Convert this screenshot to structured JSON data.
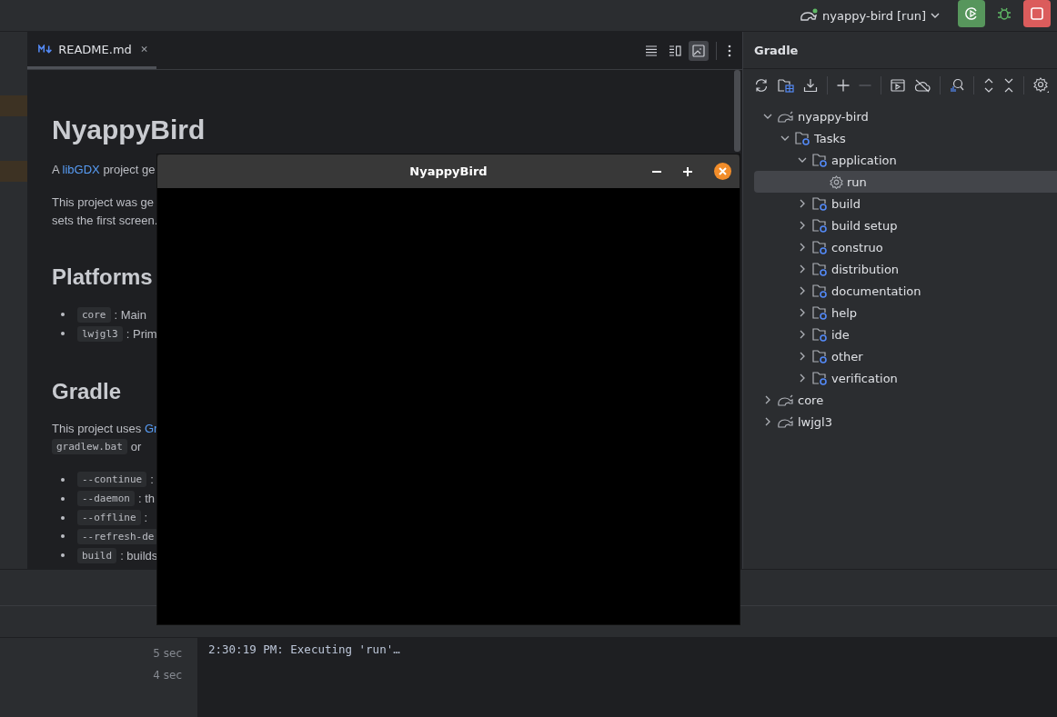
{
  "top_bar": {
    "run_config": "nyappy-bird [run]"
  },
  "editor": {
    "tabs": [
      {
        "label": "README.md",
        "selected": true
      }
    ],
    "view_modes": [
      {
        "kind": "editor",
        "selected": false
      },
      {
        "kind": "split",
        "selected": false
      },
      {
        "kind": "preview",
        "selected": true
      }
    ],
    "readme": [
      {
        "kind": "h1",
        "text": "NyappyBird"
      },
      {
        "kind": "p",
        "lines": [
          [
            {
              "kind": "text",
              "text": "A "
            },
            {
              "kind": "link",
              "text": "libGDX"
            },
            {
              "kind": "text",
              "text": " project ge"
            }
          ]
        ]
      },
      {
        "kind": "p",
        "lines": [
          [
            {
              "kind": "text",
              "text": "This project was ge"
            }
          ],
          [
            {
              "kind": "text",
              "text": "sets the first screen."
            }
          ]
        ]
      },
      {
        "kind": "h2",
        "text": "Platforms"
      },
      {
        "kind": "list",
        "items": [
          [
            {
              "kind": "code",
              "text": "core"
            },
            {
              "kind": "text",
              "text": ": Main"
            }
          ],
          [
            {
              "kind": "code",
              "text": "lwjgl3"
            },
            {
              "kind": "text",
              "text": ": Prim"
            }
          ]
        ]
      },
      {
        "kind": "h2",
        "text": "Gradle"
      },
      {
        "kind": "p",
        "lines": [
          [
            {
              "kind": "text",
              "text": "This project uses "
            },
            {
              "kind": "link",
              "text": "Gr"
            }
          ],
          [
            {
              "kind": "code",
              "text": "gradlew.bat"
            },
            {
              "kind": "text",
              "text": "or"
            }
          ]
        ]
      },
      {
        "kind": "list",
        "items": [
          [
            {
              "kind": "code",
              "text": "--continue"
            },
            {
              "kind": "text",
              "text": ":"
            }
          ],
          [
            {
              "kind": "code",
              "text": "--daemon"
            },
            {
              "kind": "text",
              "text": ": th"
            }
          ],
          [
            {
              "kind": "code",
              "text": "--offline"
            },
            {
              "kind": "text",
              "text": ":"
            }
          ],
          [
            {
              "kind": "code",
              "text": "--refresh-de"
            }
          ],
          [
            {
              "kind": "code",
              "text": "build"
            },
            {
              "kind": "text",
              "text": ": builds"
            }
          ]
        ]
      }
    ]
  },
  "game_window": {
    "title": "NyappyBird"
  },
  "gradle": {
    "title": "Gradle",
    "tree": [
      {
        "label": "nyappy-bird",
        "kind": "project",
        "expanded": true,
        "selected": false,
        "children": [
          {
            "label": "Tasks",
            "kind": "folder",
            "expanded": true,
            "selected": false,
            "children": [
              {
                "label": "application",
                "kind": "folder",
                "expanded": true,
                "selected": false,
                "children": [
                  {
                    "label": "run",
                    "kind": "task",
                    "selected": true
                  }
                ]
              },
              {
                "label": "build",
                "kind": "folder",
                "expanded": false,
                "selected": false
              },
              {
                "label": "build setup",
                "kind": "folder",
                "expanded": false,
                "selected": false
              },
              {
                "label": "construo",
                "kind": "folder",
                "expanded": false,
                "selected": false
              },
              {
                "label": "distribution",
                "kind": "folder",
                "expanded": false,
                "selected": false
              },
              {
                "label": "documentation",
                "kind": "folder",
                "expanded": false,
                "selected": false
              },
              {
                "label": "help",
                "kind": "folder",
                "expanded": false,
                "selected": false
              },
              {
                "label": "ide",
                "kind": "folder",
                "expanded": false,
                "selected": false
              },
              {
                "label": "other",
                "kind": "folder",
                "expanded": false,
                "selected": false
              },
              {
                "label": "verification",
                "kind": "folder",
                "expanded": false,
                "selected": false
              }
            ]
          }
        ]
      },
      {
        "label": "core",
        "kind": "project",
        "expanded": false,
        "selected": false
      },
      {
        "label": "lwjgl3",
        "kind": "project",
        "expanded": false,
        "selected": false
      }
    ]
  },
  "run_panel": {
    "durations": [
      "5 sec",
      "4 sec"
    ],
    "console": "2:30:19 PM: Executing 'run'…"
  }
}
